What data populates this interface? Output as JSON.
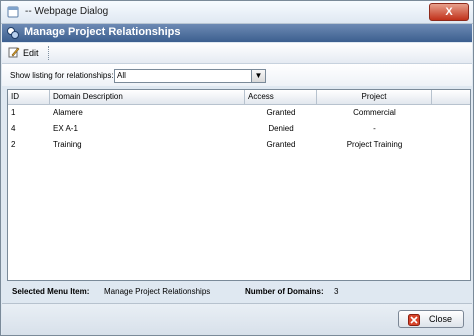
{
  "window": {
    "title": "-- Webpage Dialog",
    "close_glyph": "X"
  },
  "header": {
    "title": "Manage Project Relationships",
    "icon": "relationships-icon"
  },
  "toolbar": {
    "edit_label": "Edit",
    "edit_icon": "edit-pencil-icon"
  },
  "filter": {
    "label": "Show listing for relationships:",
    "selected": "All",
    "dropdown_glyph": "▼"
  },
  "grid": {
    "columns": [
      "ID",
      "Domain Description",
      "Access",
      "Project"
    ],
    "rows": [
      {
        "id": "1",
        "domain": "Alamere",
        "access": "Granted",
        "project": "Commercial"
      },
      {
        "id": "4",
        "domain": "EX A-1",
        "access": "Denied",
        "project": "-"
      },
      {
        "id": "2",
        "domain": "Training",
        "access": "Granted",
        "project": "Project Training"
      }
    ]
  },
  "status": {
    "selected_label": "Selected Menu Item:",
    "selected_value": "Manage Project Relationships",
    "count_label": "Number of Domains:",
    "count_value": "3"
  },
  "footer": {
    "close_label": "Close",
    "close_icon": "close-icon"
  },
  "colors": {
    "header_bg": "#4f6f9f",
    "close_red": "#c1311a",
    "panel_bg": "#dfe8f1"
  }
}
